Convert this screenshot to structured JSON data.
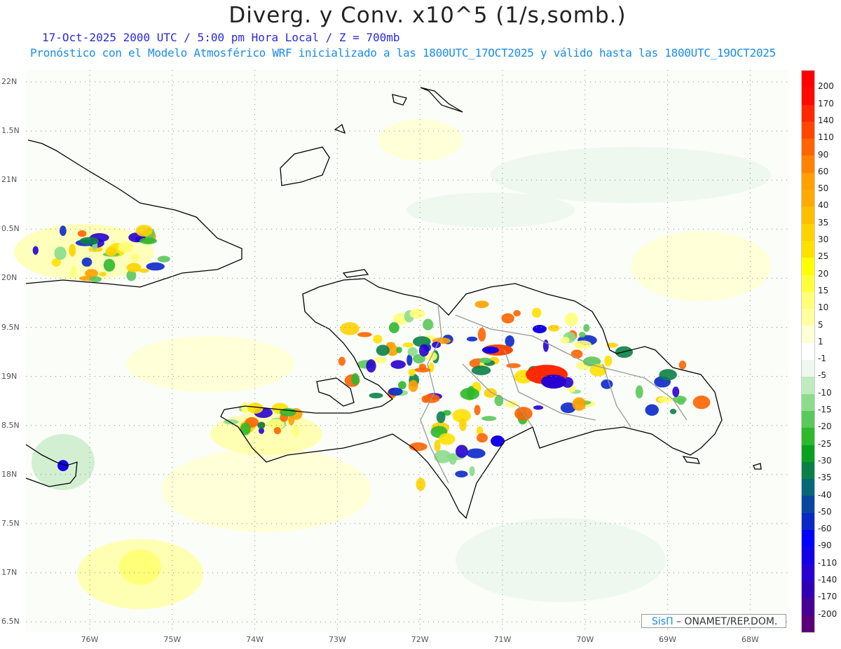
{
  "header": {
    "title": "Diverg. y Conv. x10^5 (1/s,somb.)",
    "line1": "17-Oct-2025  2000 UTC / 5:00 pm Hora Local / Z = 700mb",
    "line2": "Pronóstico con el Modelo Atmosférico WRF inicializado a las 1800UTC_17OCT2025 y válido hasta las  1800UTC_19OCT2025"
  },
  "map": {
    "lat_labels": [
      "22N",
      "1.5N",
      "21N",
      "0.5N",
      "20N",
      "9.5N",
      "19N",
      "8.5N",
      "18N",
      "7.5N",
      "17N",
      "6.5N"
    ],
    "lon_labels": [
      "76W",
      "75W",
      "74W",
      "73W",
      "72W",
      "71W",
      "70W",
      "69W",
      "68W"
    ]
  },
  "colorbar": {
    "labels": [
      "200",
      "170",
      "140",
      "110",
      "90",
      "60",
      "50",
      "40",
      "35",
      "30",
      "25",
      "20",
      "15",
      "10",
      "5",
      "1",
      "-1",
      "-5",
      "-10",
      "-15",
      "-20",
      "-25",
      "-30",
      "-35",
      "-40",
      "-50",
      "-60",
      "-90",
      "-110",
      "-140",
      "-170",
      "-200"
    ],
    "colors": [
      "#ff0000",
      "#ff0a00",
      "#ff2800",
      "#ff4600",
      "#ff6400",
      "#ff8200",
      "#ffa000",
      "#ffaa00",
      "#ffbe00",
      "#ffd200",
      "#ffe100",
      "#ffff00",
      "#ffff3c",
      "#ffff78",
      "#ffffa0",
      "#ffffd8",
      "#ffffff",
      "#eef8ee",
      "#c0eac0",
      "#8cdc8c",
      "#5ac85a",
      "#2eb82e",
      "#0aa020",
      "#0a8048",
      "#086878",
      "#0a46a0",
      "#0a28c8",
      "#0000ff",
      "#1400e6",
      "#2800d2",
      "#3200b4",
      "#460096",
      "#5a0078"
    ]
  },
  "watermark": {
    "brand": "SisΠ",
    "text": " –  ONAMET/REP.DOM."
  }
}
